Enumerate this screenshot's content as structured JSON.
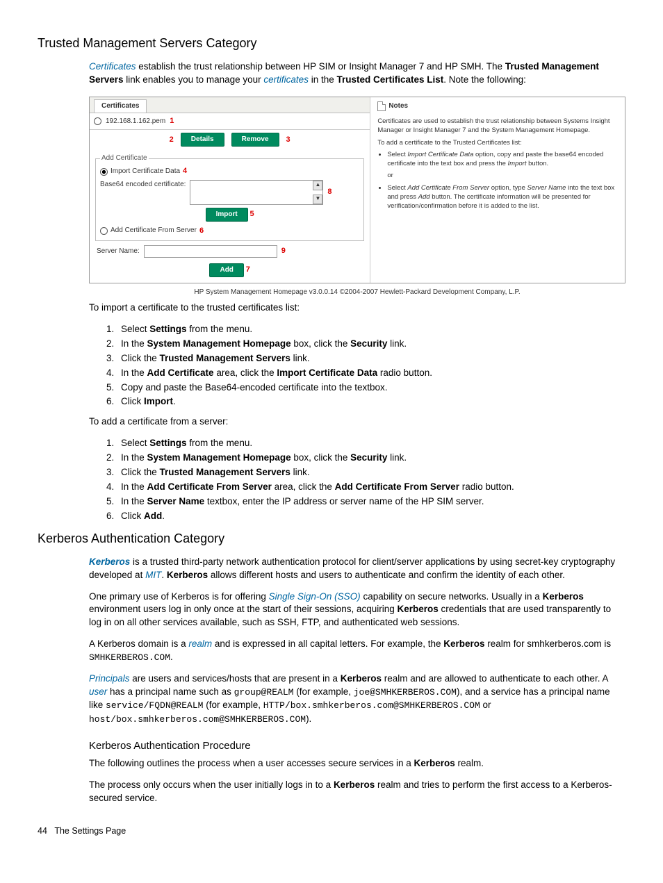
{
  "section1": {
    "title": "Trusted Management Servers Category",
    "intro_parts": {
      "certificates": "Certificates",
      "t1": " establish the trust relationship between HP SIM or Insight Manager 7 and HP SMH. The ",
      "b1": "Trusted Management Servers",
      "t2": " link enables you to manage your ",
      "certificates2": "certificates",
      "t3": " in the ",
      "b2": "Trusted Certificates List",
      "t4": ". Note the following:"
    },
    "figure": {
      "tab_title": "Certificates",
      "file_tab": "192.168.1.162.pem",
      "callouts": {
        "c1": "1",
        "c2": "2",
        "c3": "3",
        "c4": "4",
        "c5": "5",
        "c6": "6",
        "c7": "7",
        "c8": "8",
        "c9": "9"
      },
      "btn_details": "Details",
      "btn_remove": "Remove",
      "legend": "Add Certificate",
      "opt_import": "Import Certificate Data",
      "label_b64": "Base64 encoded certificate:",
      "btn_import": "Import",
      "opt_add_server": "Add Certificate From Server",
      "label_server": "Server Name:",
      "btn_add": "Add",
      "notes_title": "Notes",
      "note_p1": "Certificates are used to establish the trust relationship between Systems Insight Manager or Insight Manager 7 and the System Management Homepage.",
      "note_p2": "To add a certificate to the Trusted Certificates list:",
      "note_li1a": "Select ",
      "note_li1_i": "Import Certificate Data",
      "note_li1b": " option, copy and paste the base64 encoded certificate into the text box and press the ",
      "note_li1_i2": "Import",
      "note_li1c": " button.",
      "note_or": "or",
      "note_li2a": "Select ",
      "note_li2_i": "Add Certificate From Server",
      "note_li2b": " option, type ",
      "note_li2_i2": "Server Name",
      "note_li2c": " into the text box and press ",
      "note_li2_i3": "Add",
      "note_li2d": " button. The certificate information will be presented for verification/confirmation before it is added to the list.",
      "caption": "HP System Management Homepage v3.0.0.14    ©2004-2007 Hewlett-Packard Development Company, L.P."
    },
    "import_intro": "To import a certificate to the trusted certificates list:",
    "import_steps": [
      {
        "pre": "Select ",
        "b": "Settings",
        "post": " from the menu."
      },
      {
        "pre": "In the ",
        "b": "System Management Homepage",
        "mid": " box, click the ",
        "b2": "Security",
        "post": " link."
      },
      {
        "pre": "Click the ",
        "b": "Trusted Management Servers",
        "post": " link."
      },
      {
        "pre": "In the ",
        "b": "Add Certificate",
        "mid": " area, click the ",
        "b2": "Import Certificate Data",
        "post": " radio button."
      },
      {
        "pre": "Copy and paste the Base64-encoded certificate into the textbox.",
        "b": "",
        "post": ""
      },
      {
        "pre": "Click ",
        "b": "Import",
        "post": "."
      }
    ],
    "add_intro": "To add a certificate from a server:",
    "add_steps": [
      {
        "pre": "Select ",
        "b": "Settings",
        "post": " from the menu."
      },
      {
        "pre": "In the ",
        "b": "System Management Homepage",
        "mid": " box, click the ",
        "b2": "Security",
        "post": " link."
      },
      {
        "pre": "Click the ",
        "b": "Trusted Management Servers",
        "post": " link."
      },
      {
        "pre": "In the ",
        "b": "Add Certificate From Server",
        "mid": " area, click the ",
        "b2": "Add Certificate From Server",
        "post": " radio button."
      },
      {
        "pre": "In the ",
        "b": "Server Name",
        "post": " textbox, enter the IP address or server name of the HP SIM server."
      },
      {
        "pre": "Click ",
        "b": "Add",
        "post": "."
      }
    ]
  },
  "section2": {
    "title": "Kerberos Authentication Category",
    "p1": {
      "kerberos": "Kerberos",
      "sp": " ",
      "t1": " is a trusted third-party network authentication protocol for client/server applications by using secret-key cryptography developed at ",
      "mit": "MIT",
      "t2": ". ",
      "b1": "Kerberos",
      "t3": " allows different hosts and users to authenticate and confirm the identity of each other."
    },
    "p2": {
      "t1": "One primary use of Kerberos is for offering ",
      "sso": "Single Sign-On (SSO)",
      "t2": " capability on secure networks. Usually in a ",
      "b1": "Kerberos",
      "t3": " environment users log in only once at the start of their sessions, acquiring ",
      "b2": "Kerberos",
      "t4": " credentials that are used transparently to log in on all other services available, such as SSH, FTP, and authenticated web sessions."
    },
    "p3": {
      "t1": "A Kerberos domain is a ",
      "realm": "realm",
      "t2": " and is expressed in all capital letters. For example, the ",
      "b1": "Kerberos",
      "t3": " realm for smhkerberos.com is ",
      "m1": "SMHKERBEROS.COM",
      "t4": "."
    },
    "p4": {
      "principals": "Principals",
      "t1": " are users and services/hosts that are present in a ",
      "b1": "Kerberos",
      "t2": " realm and are allowed to authenticate to each other. A ",
      "user": "user",
      "t3": " has a principal name such as ",
      "m1": "group@REALM",
      "t4": " (for example, ",
      "m2": "joe@SMHKERBEROS.COM",
      "t5": "), and a service has a principal name like ",
      "m3": "service/FQDN@REALM",
      "t6": " (for example, ",
      "m4": "HTTP/box.smhkerberos.com@SMHKERBEROS.COM",
      "t7": " or ",
      "m5": "host/box.smhkerberos.com@SMHKERBEROS.COM",
      "t8": ")."
    },
    "sub_title": "Kerberos Authentication Procedure",
    "p5": {
      "t1": "The following outlines the process when a user accesses secure services in a ",
      "b1": "Kerberos",
      "t2": " realm."
    },
    "p6": {
      "t1": "The process only occurs when the user initially logs in to a ",
      "b1": "Kerberos",
      "t2": " realm and tries to perform the first access to a Kerberos-secured service."
    }
  },
  "footer": {
    "page": "44",
    "label": "The Settings Page"
  }
}
